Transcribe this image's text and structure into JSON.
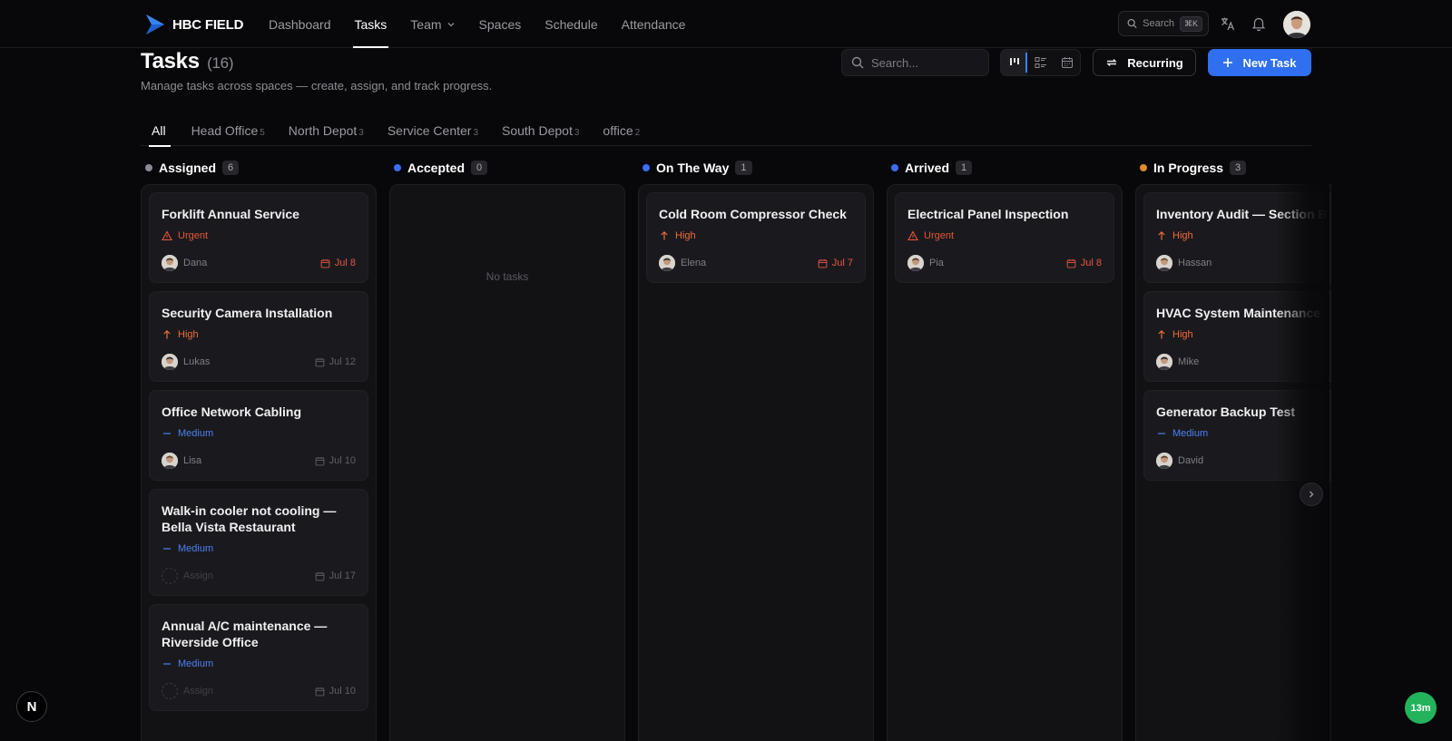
{
  "app": {
    "logo_text": "HBC FIELD",
    "accent_color": "#2f6ff0"
  },
  "nav": {
    "items": [
      {
        "label": "Dashboard"
      },
      {
        "label": "Tasks"
      },
      {
        "label": "Team"
      },
      {
        "label": "Spaces"
      },
      {
        "label": "Schedule"
      },
      {
        "label": "Attendance"
      }
    ],
    "active": "Tasks",
    "search_label": "Search",
    "search_shortcut": "⌘K"
  },
  "header": {
    "title": "Tasks",
    "count": "(16)",
    "subtitle": "Manage tasks across spaces — create, assign, and track progress.",
    "search_placeholder": "Search...",
    "recurring_label": "Recurring",
    "new_task_label": "New Task"
  },
  "tabs": [
    {
      "label": "All",
      "count": ""
    },
    {
      "label": "Head Office",
      "count": "5"
    },
    {
      "label": "North Depot",
      "count": "3"
    },
    {
      "label": "Service Center",
      "count": "3"
    },
    {
      "label": "South Depot",
      "count": "3"
    },
    {
      "label": "office",
      "count": "2"
    }
  ],
  "columns": [
    {
      "title": "Assigned",
      "count": "6",
      "dot_color": "#8a8a92",
      "empty_text": "",
      "cards": [
        {
          "title": "Forklift Annual Service",
          "priority": "Urgent",
          "assignee": "Dana",
          "due": "Jul 8"
        },
        {
          "title": "Security Camera Installation",
          "priority": "High",
          "assignee": "Lukas",
          "due": "Jul 12"
        },
        {
          "title": "Office Network Cabling",
          "priority": "Medium",
          "assignee": "Lisa",
          "due": "Jul 10"
        },
        {
          "title": "Walk-in cooler not cooling — Bella Vista Restaurant",
          "priority": "Medium",
          "assignee": "Assign",
          "due": "Jul 17"
        },
        {
          "title": "Annual A/C maintenance — Riverside Office",
          "priority": "Medium",
          "assignee": "Assign",
          "due": "Jul 10"
        }
      ]
    },
    {
      "title": "Accepted",
      "count": "0",
      "dot_color": "#3b6ef5",
      "empty_text": "No tasks",
      "cards": []
    },
    {
      "title": "On The Way",
      "count": "1",
      "dot_color": "#3b6ef5",
      "empty_text": "",
      "cards": [
        {
          "title": "Cold Room Compressor Check",
          "priority": "High",
          "assignee": "Elena",
          "due": "Jul 7"
        }
      ]
    },
    {
      "title": "Arrived",
      "count": "1",
      "dot_color": "#3b6ef5",
      "empty_text": "",
      "cards": [
        {
          "title": "Electrical Panel Inspection",
          "priority": "Urgent",
          "assignee": "Pia",
          "due": "Jul 8"
        }
      ]
    },
    {
      "title": "In Progress",
      "count": "3",
      "dot_color": "#e0892a",
      "empty_text": "",
      "cards": [
        {
          "title": "Inventory Audit — Section B",
          "priority": "High",
          "assignee": "Hassan",
          "due": ""
        },
        {
          "title": "HVAC System Maintenance",
          "priority": "High",
          "assignee": "Mike",
          "due": ""
        },
        {
          "title": "Generator Backup Test",
          "priority": "Medium",
          "assignee": "David",
          "due": ""
        }
      ]
    }
  ],
  "badges": {
    "framework": "N",
    "timer": "13m"
  }
}
